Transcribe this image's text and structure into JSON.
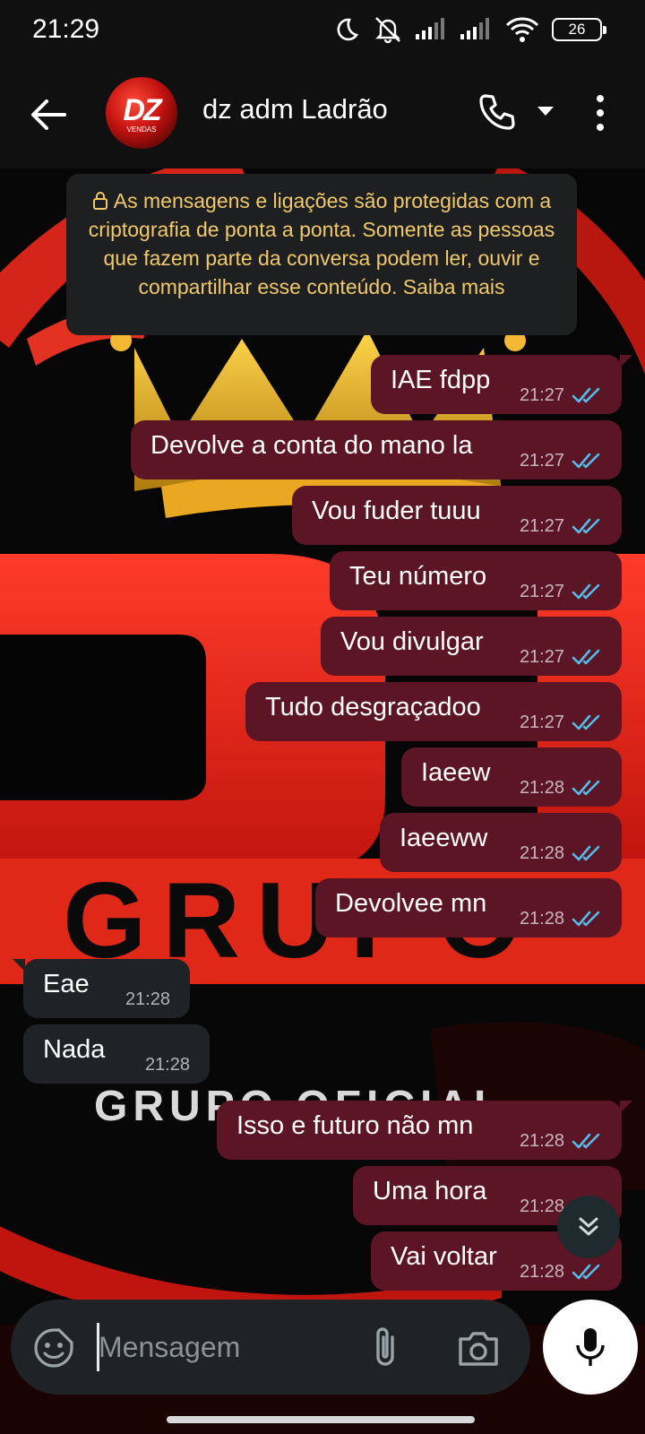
{
  "status_bar": {
    "time": "21:29",
    "battery": "26"
  },
  "header": {
    "contact_name": "dz adm Ladrão",
    "avatar_text": "DZ",
    "avatar_subtext": "VENDAS"
  },
  "wallpaper": {
    "text_1": "GRUPO",
    "text_2": "GRUPO OFICIAL"
  },
  "encryption_notice": "As mensagens e ligações são protegidas com a criptografia de ponta a ponta. Somente as pessoas que fazem parte da conversa podem ler, ouvir e compartilhar esse conteúdo. Saiba mais",
  "messages": [
    {
      "direction": "out",
      "text": "IAE fdpp",
      "time": "21:27",
      "status": "read"
    },
    {
      "direction": "out",
      "text": "Devolve a conta do mano la",
      "time": "21:27",
      "status": "read"
    },
    {
      "direction": "out",
      "text": "Vou fuder tuuu",
      "time": "21:27",
      "status": "read"
    },
    {
      "direction": "out",
      "text": "Teu número",
      "time": "21:27",
      "status": "read"
    },
    {
      "direction": "out",
      "text": "Vou divulgar",
      "time": "21:27",
      "status": "read"
    },
    {
      "direction": "out",
      "text": "Tudo desgraçadoo",
      "time": "21:27",
      "status": "read"
    },
    {
      "direction": "out",
      "text": "Iaeew",
      "time": "21:28",
      "status": "read"
    },
    {
      "direction": "out",
      "text": "Iaeeww",
      "time": "21:28",
      "status": "read"
    },
    {
      "direction": "out",
      "text": "Devolvee mn",
      "time": "21:28",
      "status": "read"
    },
    {
      "direction": "in",
      "text": "Eae",
      "time": "21:28"
    },
    {
      "direction": "in",
      "text": "Nada",
      "time": "21:28"
    },
    {
      "direction": "out",
      "text": "Isso e futuro não mn",
      "time": "21:28",
      "status": "read"
    },
    {
      "direction": "out",
      "text": "Uma hora",
      "time": "21:28",
      "status": "read"
    },
    {
      "direction": "out",
      "text": "Vai voltar",
      "time": "21:28",
      "status": "read"
    }
  ],
  "input": {
    "placeholder": "Mensagem",
    "value": ""
  },
  "colors": {
    "outgoing_bubble": "#5b1525",
    "incoming_bubble": "#1f2325",
    "read_ticks": "#53bdeb",
    "notice_text": "#f1c96b"
  },
  "icons": {
    "back": "arrow-left-icon",
    "call": "phone-icon",
    "menu": "more-vertical-icon",
    "emoji": "sticker-icon",
    "attach": "paperclip-icon",
    "camera": "camera-icon",
    "mic": "mic-icon",
    "scroll": "double-chevron-down-icon"
  }
}
